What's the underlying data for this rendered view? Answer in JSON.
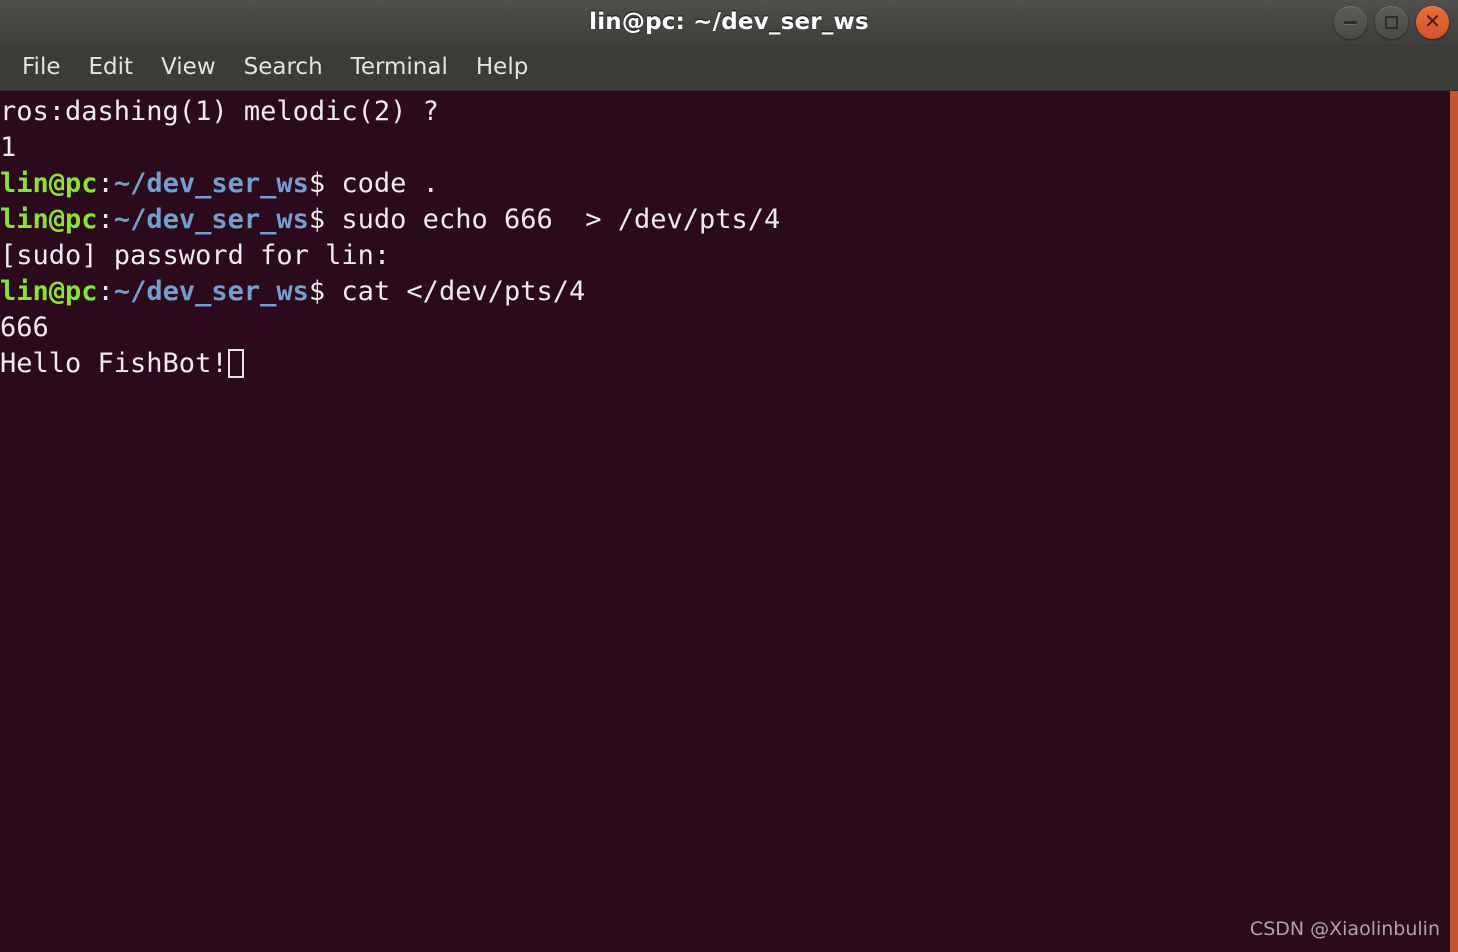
{
  "window": {
    "title": "lin@pc: ~/dev_ser_ws",
    "controls": {
      "minimize_label": "−",
      "maximize_label": "□",
      "close_label": "✕"
    },
    "colors": {
      "titlebar_bg": "#494743",
      "menubar_bg": "#3d3b38",
      "terminal_bg": "#2b0a1c",
      "scrollbar": "#c2552c",
      "prompt_user": "#8ae234",
      "prompt_path": "#729fcf",
      "text": "#e8e3e3",
      "close_button": "#d2522a"
    }
  },
  "menubar": {
    "items": [
      {
        "label": "File"
      },
      {
        "label": "Edit"
      },
      {
        "label": "View"
      },
      {
        "label": "Search"
      },
      {
        "label": "Terminal"
      },
      {
        "label": "Help"
      }
    ]
  },
  "terminal": {
    "prompt": {
      "user_host": "lin@pc",
      "colon": ":",
      "path": "~/dev_ser_ws",
      "symbol": "$ "
    },
    "lines": [
      {
        "type": "output",
        "text": "ros:dashing(1) melodic(2) ?"
      },
      {
        "type": "output",
        "text": "1"
      },
      {
        "type": "command",
        "text": "code ."
      },
      {
        "type": "command",
        "text": "sudo echo 666  > /dev/pts/4"
      },
      {
        "type": "output",
        "text": "[sudo] password for lin:"
      },
      {
        "type": "command",
        "text": "cat </dev/pts/4"
      },
      {
        "type": "output",
        "text": "666"
      },
      {
        "type": "output",
        "text": "Hello FishBot!",
        "cursor": true
      }
    ]
  },
  "watermark": {
    "text": "CSDN @Xiaolinbulin"
  }
}
